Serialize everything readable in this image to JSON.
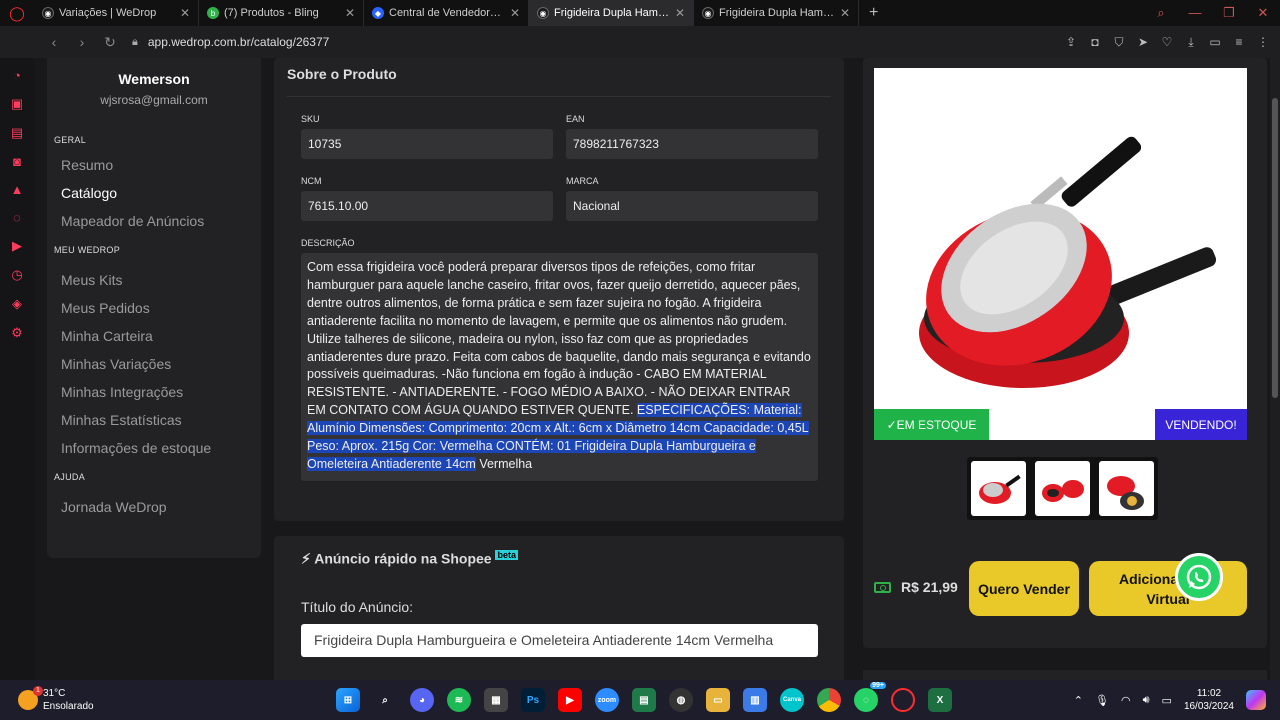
{
  "browser": {
    "tabs": [
      {
        "title": "Variações | WeDrop",
        "color": "#1a1a1a",
        "glyph": "◉"
      },
      {
        "title": "(7) Produtos - Bling",
        "color": "#2fb14a",
        "glyph": "b"
      },
      {
        "title": "Central de Vendedores Glo",
        "color": "#2962ff",
        "glyph": "◆"
      },
      {
        "title": "Frigideira Dupla Hamburgu",
        "color": "#1a1a1a",
        "glyph": "◉"
      },
      {
        "title": "Frigideira Dupla Hamburgu",
        "color": "#1a1a1a",
        "glyph": "◉"
      }
    ],
    "url": "app.wedrop.com.br/catalog/26377"
  },
  "sidebar": {
    "user_name": "Wemerson",
    "user_email": "wjsrosa@gmail.com",
    "section_geral": "GERAL",
    "geral_items": [
      "Resumo",
      "Catálogo",
      "Mapeador de Anúncios"
    ],
    "section_meu": "MEU WEDROP",
    "meu_items": [
      "Meus Kits",
      "Meus Pedidos",
      "Minha Carteira",
      "Minhas Variações",
      "Minhas Integrações",
      "Minhas Estatísticas",
      "Informações de estoque"
    ],
    "section_ajuda": "AJUDA",
    "ajuda_items": [
      "Jornada WeDrop"
    ]
  },
  "product": {
    "section_title": "Sobre o Produto",
    "sku_label": "SKU",
    "sku": "10735",
    "ean_label": "EAN",
    "ean": "7898211767323",
    "ncm_label": "NCM",
    "ncm": "7615.10.00",
    "marca_label": "MARCA",
    "marca": "Nacional",
    "desc_label": "DESCRIÇÃO",
    "desc_text": "Com essa frigideira você poderá preparar diversos tipos de refeições, como fritar hamburguer para aquele lanche caseiro, fritar ovos, fazer queijo derretido, aquecer pães, dentre outros alimentos, de forma prática e sem fazer sujeira no fogão.  A frigideira antiaderente facilita no momento de lavagem, e permite que os alimentos não grudem. Utilize talheres de silicone, madeira ou nylon, isso faz com que as propriedades antiaderentes dure  prazo. Feita com cabos de baquelite, dando mais segurança e evitando possíveis queimaduras. -Não funciona em fogão à indução - CABO EM MATERIAL RESISTENTE. - ANTIADERENTE. - FOGO MÉDIO A BAIXO. - NÃO DEIXAR ENTRAR EM CONTATO COM ÁGUA QUANDO ESTIVER QUENTE. ",
    "desc_selected": "ESPECIFICAÇÕES: Material: Alumínio Dimensões: Comprimento: 20cm x Alt.: 6cm x Diâmetro 14cm Capacidade: 0,45L Peso: Aprox. 215g   Cor: Vermelha   CONTÉM:   01 Frigideira Dupla Hamburgueira e Omeleteira Antiaderente 14cm",
    "desc_tail": " Vermelha"
  },
  "shopee": {
    "title": "Anúncio rápido na Shopee",
    "beta": "beta",
    "field_label": "Título do Anúncio:",
    "field_value": "Frigideira Dupla Hamburgueira e Omeleteira Antiaderente 14cm Vermelha"
  },
  "right": {
    "stock_badge": "EM ESTOQUE",
    "selling_badge": "VENDENDO!",
    "price": "R$ 21,99",
    "btn_quero": "Quero Vender",
    "btn_sku": "Adicionar SKU Virtual"
  },
  "taskbar": {
    "temp": "31°C",
    "weather": "Ensolarado",
    "time": "11:02",
    "date": "16/03/2024",
    "badge_count": "99+"
  },
  "colors": {
    "accent_yellow": "#e9c82a",
    "stock_green": "#1fb34a",
    "selling_purple": "#3a24d8",
    "selection_blue": "#1c46b5",
    "opera_red": "#ff2d2d"
  }
}
